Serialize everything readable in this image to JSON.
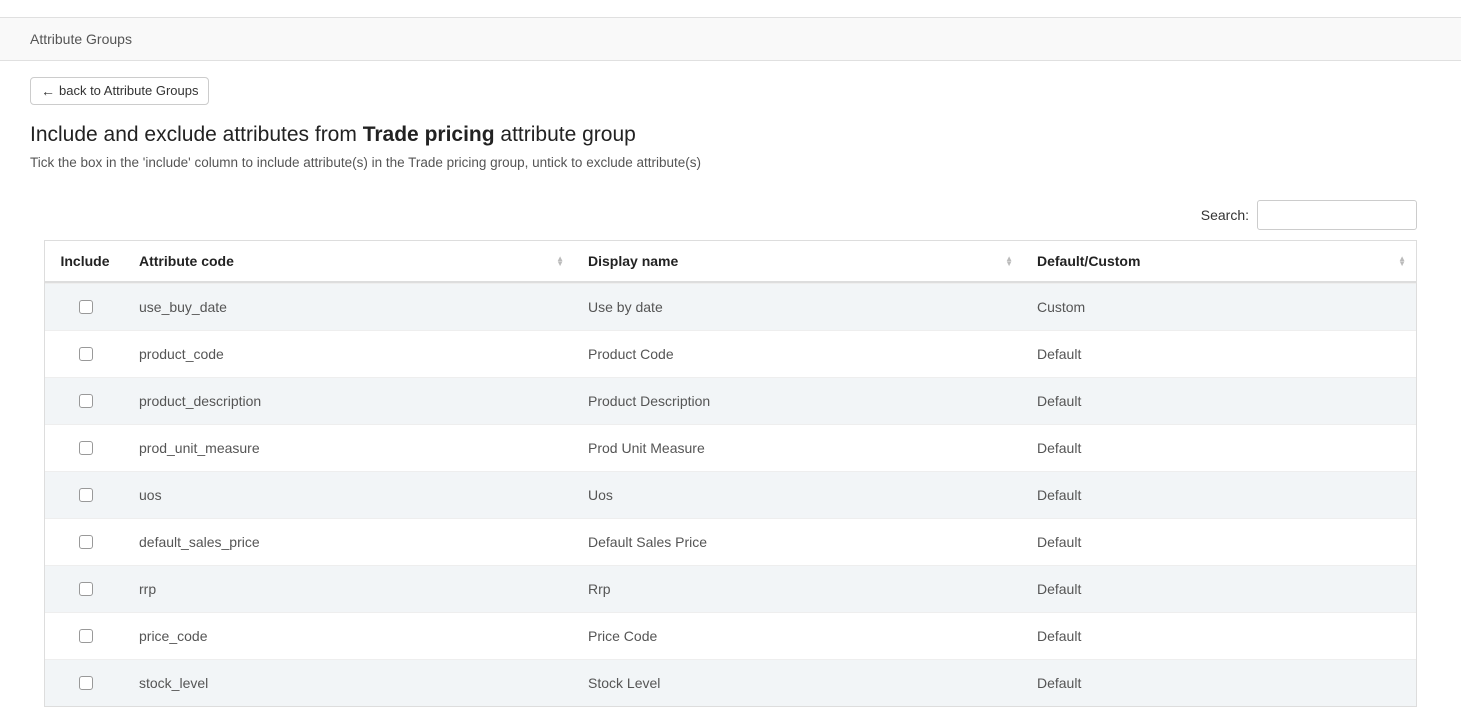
{
  "breadcrumb": {
    "current": "Attribute Groups"
  },
  "back_button": {
    "label": "back to Attribute Groups"
  },
  "title": {
    "prefix": "Include and exclude attributes from ",
    "group_name": "Trade pricing",
    "suffix": " attribute group"
  },
  "subtitle": "Tick the box in the 'include' column to include attribute(s) in the Trade pricing group, untick to exclude attribute(s)",
  "search": {
    "label": "Search:",
    "value": ""
  },
  "table": {
    "columns": {
      "include": "Include",
      "attribute_code": "Attribute code",
      "display_name": "Display name",
      "default_custom": "Default/Custom"
    },
    "rows": [
      {
        "include": false,
        "code": "use_buy_date",
        "display": "Use by date",
        "kind": "Custom"
      },
      {
        "include": false,
        "code": "product_code",
        "display": "Product Code",
        "kind": "Default"
      },
      {
        "include": false,
        "code": "product_description",
        "display": "Product Description",
        "kind": "Default"
      },
      {
        "include": false,
        "code": "prod_unit_measure",
        "display": "Prod Unit Measure",
        "kind": "Default"
      },
      {
        "include": false,
        "code": "uos",
        "display": "Uos",
        "kind": "Default"
      },
      {
        "include": false,
        "code": "default_sales_price",
        "display": "Default Sales Price",
        "kind": "Default"
      },
      {
        "include": false,
        "code": "rrp",
        "display": "Rrp",
        "kind": "Default"
      },
      {
        "include": false,
        "code": "price_code",
        "display": "Price Code",
        "kind": "Default"
      },
      {
        "include": false,
        "code": "stock_level",
        "display": "Stock Level",
        "kind": "Default"
      }
    ]
  }
}
